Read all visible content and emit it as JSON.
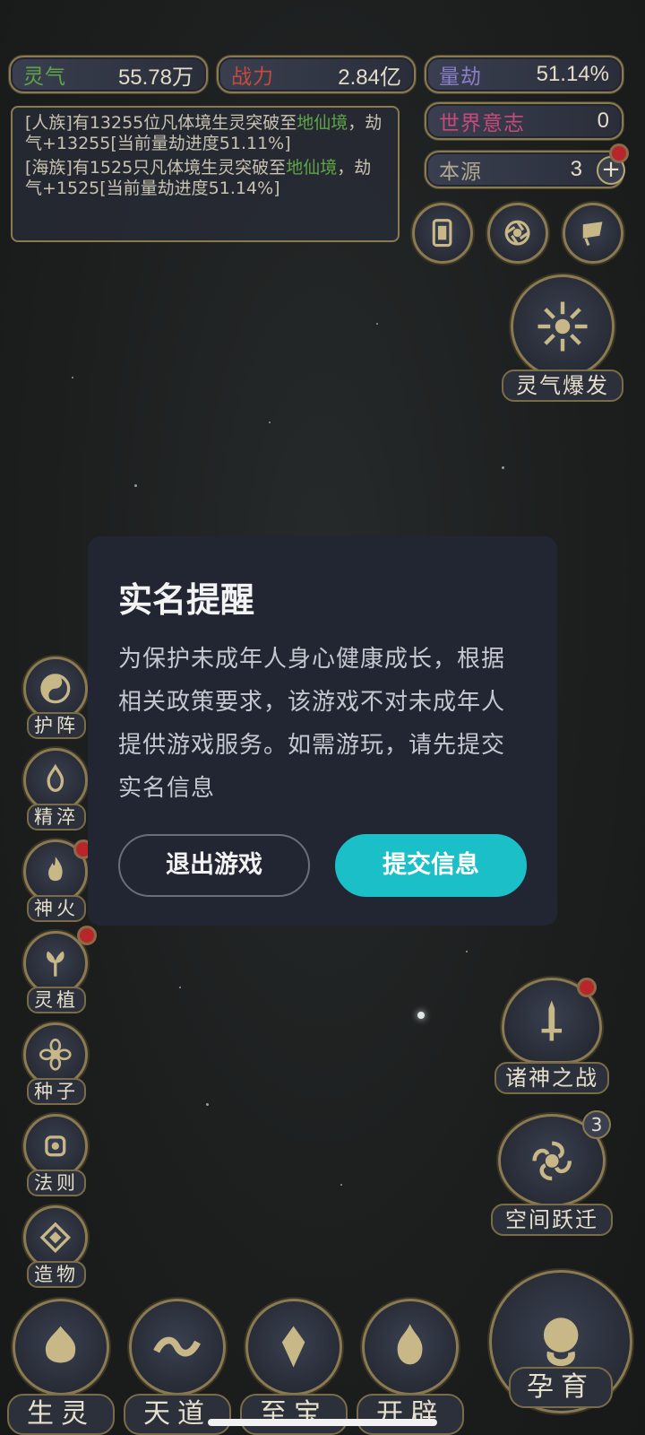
{
  "stats": {
    "lingqi": {
      "label": "灵气",
      "value": "55.78万",
      "color": "#5fa548"
    },
    "zhanli": {
      "label": "战力",
      "value": "2.84亿",
      "color": "#c84a3a"
    },
    "liangjie": {
      "label": "量劫",
      "value": "51.14%",
      "color": "#8a7ec8"
    },
    "shijie": {
      "label": "世界意志",
      "value": "0",
      "color": "#c84a7a"
    },
    "benyuan": {
      "label": "本源",
      "value": "3",
      "color": "#b0a890"
    }
  },
  "log": {
    "entry1": {
      "prefix": "[人族]有13255位凡体境生灵突破至",
      "highlight": "地仙境",
      "suffix": "，劫气+13255[当前量劫进度51.11%]"
    },
    "entry2": {
      "prefix": "[海族]有1525只凡体境生灵突破至",
      "highlight": "地仙境",
      "suffix": "，劫气+1525[当前量劫进度51.14%]"
    }
  },
  "right_buttons": {
    "burst": "灵气爆发",
    "war": "诸神之战",
    "jump": "空间跃迁",
    "jump_badge": "3"
  },
  "side_buttons": [
    "护阵",
    "精淬",
    "神火",
    "灵植",
    "种子",
    "法则",
    "造物"
  ],
  "bottom_buttons": [
    "生灵",
    "天道",
    "至宝",
    "开辟",
    "孕育"
  ],
  "modal": {
    "title": "实名提醒",
    "body": "为保护未成年人身心健康成长，根据相关政策要求，该游戏不对未成年人提供游戏服务。如需游玩，请先提交实名信息",
    "exit_label": "退出游戏",
    "submit_label": "提交信息",
    "accent": "#1bbfc8"
  }
}
